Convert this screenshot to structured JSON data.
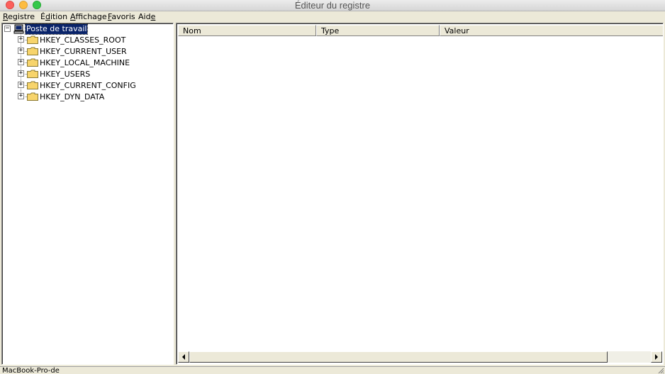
{
  "window": {
    "title": "Éditeur du registre"
  },
  "menu": {
    "items": [
      {
        "pre": "",
        "key": "R",
        "post": "egistre"
      },
      {
        "pre": "É",
        "key": "d",
        "post": "ition"
      },
      {
        "pre": "",
        "key": "A",
        "post": "ffichage"
      },
      {
        "pre": "",
        "key": "F",
        "post": "avoris"
      },
      {
        "pre": "Aid",
        "key": "e",
        "post": ""
      }
    ]
  },
  "tree": {
    "root": {
      "label": "Poste de travail",
      "expander": "−"
    },
    "keys": [
      {
        "label": "HKEY_CLASSES_ROOT",
        "expander": "+"
      },
      {
        "label": "HKEY_CURRENT_USER",
        "expander": "+"
      },
      {
        "label": "HKEY_LOCAL_MACHINE",
        "expander": "+"
      },
      {
        "label": "HKEY_USERS",
        "expander": "+"
      },
      {
        "label": "HKEY_CURRENT_CONFIG",
        "expander": "+"
      },
      {
        "label": "HKEY_DYN_DATA",
        "expander": "+"
      }
    ]
  },
  "list": {
    "columns": [
      "Nom",
      "Type",
      "Valeur"
    ]
  },
  "status": {
    "text": "MacBook-Pro-de"
  },
  "colors": {
    "selection": "#0a246a",
    "folder": "#f7d46b",
    "chrome": "#ece9d8"
  }
}
